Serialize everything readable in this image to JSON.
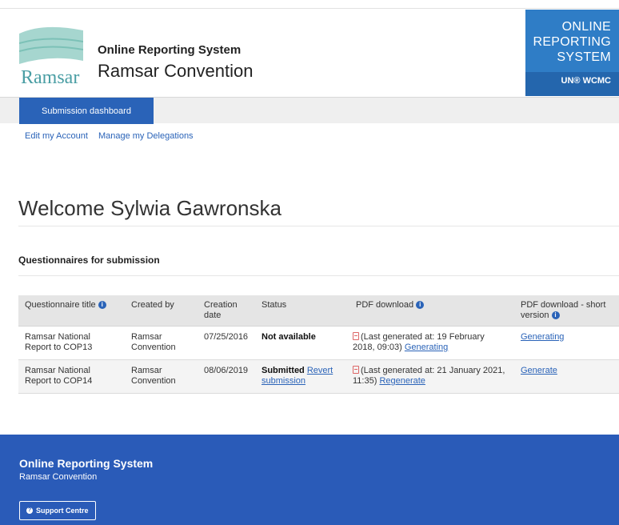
{
  "header": {
    "logo_text": "Ramsar",
    "subtitle": "Online Reporting System",
    "title": "Ramsar Convention",
    "badge_lines": [
      "ONLINE",
      "REPORTING",
      "SYSTEM"
    ],
    "badge_logo": "UN® WCMC"
  },
  "nav": {
    "tab": "Submission dashboard",
    "links": [
      "Edit my Account",
      "Manage my Delegations"
    ]
  },
  "main": {
    "welcome": "Welcome Sylwia Gawronska",
    "section_title": "Questionnaires for submission",
    "table": {
      "headers": [
        "Questionnaire title",
        "Created by",
        "Creation date",
        "Status",
        "PDF download",
        "PDF download - short version"
      ],
      "rows": [
        {
          "title": "Ramsar National Report to COP13",
          "created_by": "Ramsar Convention",
          "date": "07/25/2016",
          "status": "Not available",
          "status_link": "",
          "pdf_text": "(Last generated at: 19 February 2018, 09:03)",
          "pdf_link": "Generating",
          "short_link": "Generating"
        },
        {
          "title": "Ramsar National Report to COP14",
          "created_by": "Ramsar Convention",
          "date": "08/06/2019",
          "status": "Submitted",
          "status_link": "Revert submission",
          "pdf_text": "(Last generated at: 21 January 2021, 11:35)",
          "pdf_link": "Regenerate",
          "short_link": "Generate"
        }
      ]
    }
  },
  "footer": {
    "title": "Online Reporting System",
    "subtitle": "Ramsar Convention",
    "support_label": "Support Centre"
  },
  "colors": {
    "primary_blue": "#2a63b8",
    "badge_blue": "#2f7dc6",
    "footer_blue": "#2a5bb8"
  }
}
